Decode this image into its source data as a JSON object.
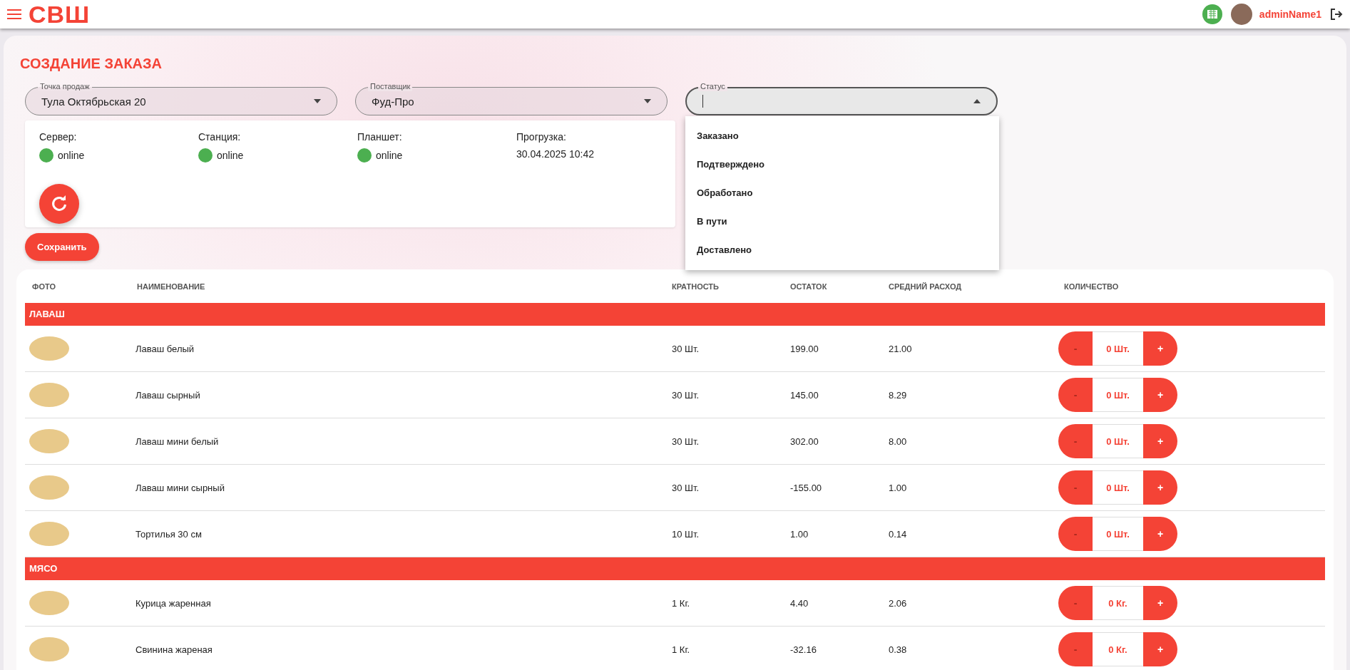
{
  "header": {
    "logo": "СВШ",
    "username": "adminName1"
  },
  "page": {
    "title": "СОЗДАНИЕ ЗАКАЗА"
  },
  "filters": [
    {
      "label": "Точка продаж",
      "value": "Тула Октябрьская 20",
      "expanded": false
    },
    {
      "label": "Поставщик",
      "value": "Фуд-Про",
      "expanded": false
    },
    {
      "label": "Статус",
      "expanded": true,
      "options": [
        "Заказано",
        "Подтверждено",
        "Обработано",
        "В пути",
        "Доставлено"
      ]
    }
  ],
  "status_panel": {
    "items": [
      {
        "label": "Сервер:",
        "value": "online",
        "kind": "status",
        "color": "#4caf50"
      },
      {
        "label": "Станция:",
        "value": "online",
        "kind": "status",
        "color": "#4caf50"
      },
      {
        "label": "Планшет:",
        "value": "online",
        "kind": "status",
        "color": "#4caf50"
      },
      {
        "label": "Прогрузка:",
        "value": "30.04.2025 10:42",
        "kind": "text"
      }
    ]
  },
  "save_button": "Сохранить",
  "table": {
    "columns": [
      "ФОТО",
      "НАИМЕНОВАНИЕ",
      "КРАТНОСТЬ",
      "ОСТАТОК",
      "СРЕДНИЙ РАСХОД",
      "КОЛИЧЕСТВО"
    ],
    "groups": [
      {
        "name": "ЛАВАШ",
        "rows": [
          {
            "name": "Лаваш белый",
            "multiplicity": "30 Шт.",
            "stock": "199.00",
            "avg_usage": "21.00",
            "quantity": "0 Шт.",
            "minus": "-",
            "plus": "+",
            "minus_disabled": true
          },
          {
            "name": "Лаваш сырный",
            "multiplicity": "30 Шт.",
            "stock": "145.00",
            "avg_usage": "8.29",
            "quantity": "0 Шт.",
            "minus": "-",
            "plus": "+",
            "minus_disabled": true
          },
          {
            "name": "Лаваш мини белый",
            "multiplicity": "30 Шт.",
            "stock": "302.00",
            "avg_usage": "8.00",
            "quantity": "0 Шт.",
            "minus": "-",
            "plus": "+",
            "minus_disabled": true
          },
          {
            "name": "Лаваш мини сырный",
            "multiplicity": "30 Шт.",
            "stock": "-155.00",
            "avg_usage": "1.00",
            "quantity": "0 Шт.",
            "minus": "-",
            "plus": "+",
            "minus_disabled": true
          },
          {
            "name": "Тортилья 30 см",
            "multiplicity": "10 Шт.",
            "stock": "1.00",
            "avg_usage": "0.14",
            "quantity": "0 Шт.",
            "minus": "-",
            "plus": "+",
            "minus_disabled": true
          }
        ]
      },
      {
        "name": "МЯСО",
        "rows": [
          {
            "name": "Курица жаренная",
            "multiplicity": "1 Кг.",
            "stock": "4.40",
            "avg_usage": "2.06",
            "quantity": "0 Кг.",
            "minus": "-",
            "plus": "+",
            "minus_disabled": true
          },
          {
            "name": "Свинина жареная",
            "multiplicity": "1 Кг.",
            "stock": "-32.16",
            "avg_usage": "0.38",
            "quantity": "0 Кг.",
            "minus": "-",
            "plus": "+",
            "minus_disabled": true
          }
        ]
      }
    ]
  }
}
